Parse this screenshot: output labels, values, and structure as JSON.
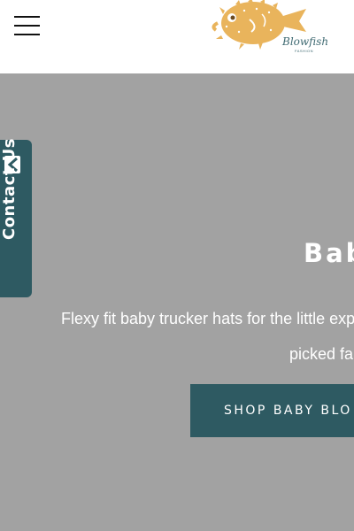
{
  "header": {
    "menu_icon": "hamburger-menu-icon",
    "logo": {
      "script_text": "Blowfish",
      "sub_text": "FASHION",
      "fish_color": "#E9B45C",
      "text_color": "#3F6A72"
    }
  },
  "contact_tab": {
    "label": "Contact Us",
    "icon": "contact-form-icon",
    "color": "#2E5A62"
  },
  "hero": {
    "title": "Bab",
    "description_line_1": "Flexy fit baby trucker hats for the little exp",
    "description_line_2": "picked fal",
    "button_label": "SHOP BABY BLO",
    "background_color": "#A2A2A2",
    "button_color": "#2E5A62"
  }
}
